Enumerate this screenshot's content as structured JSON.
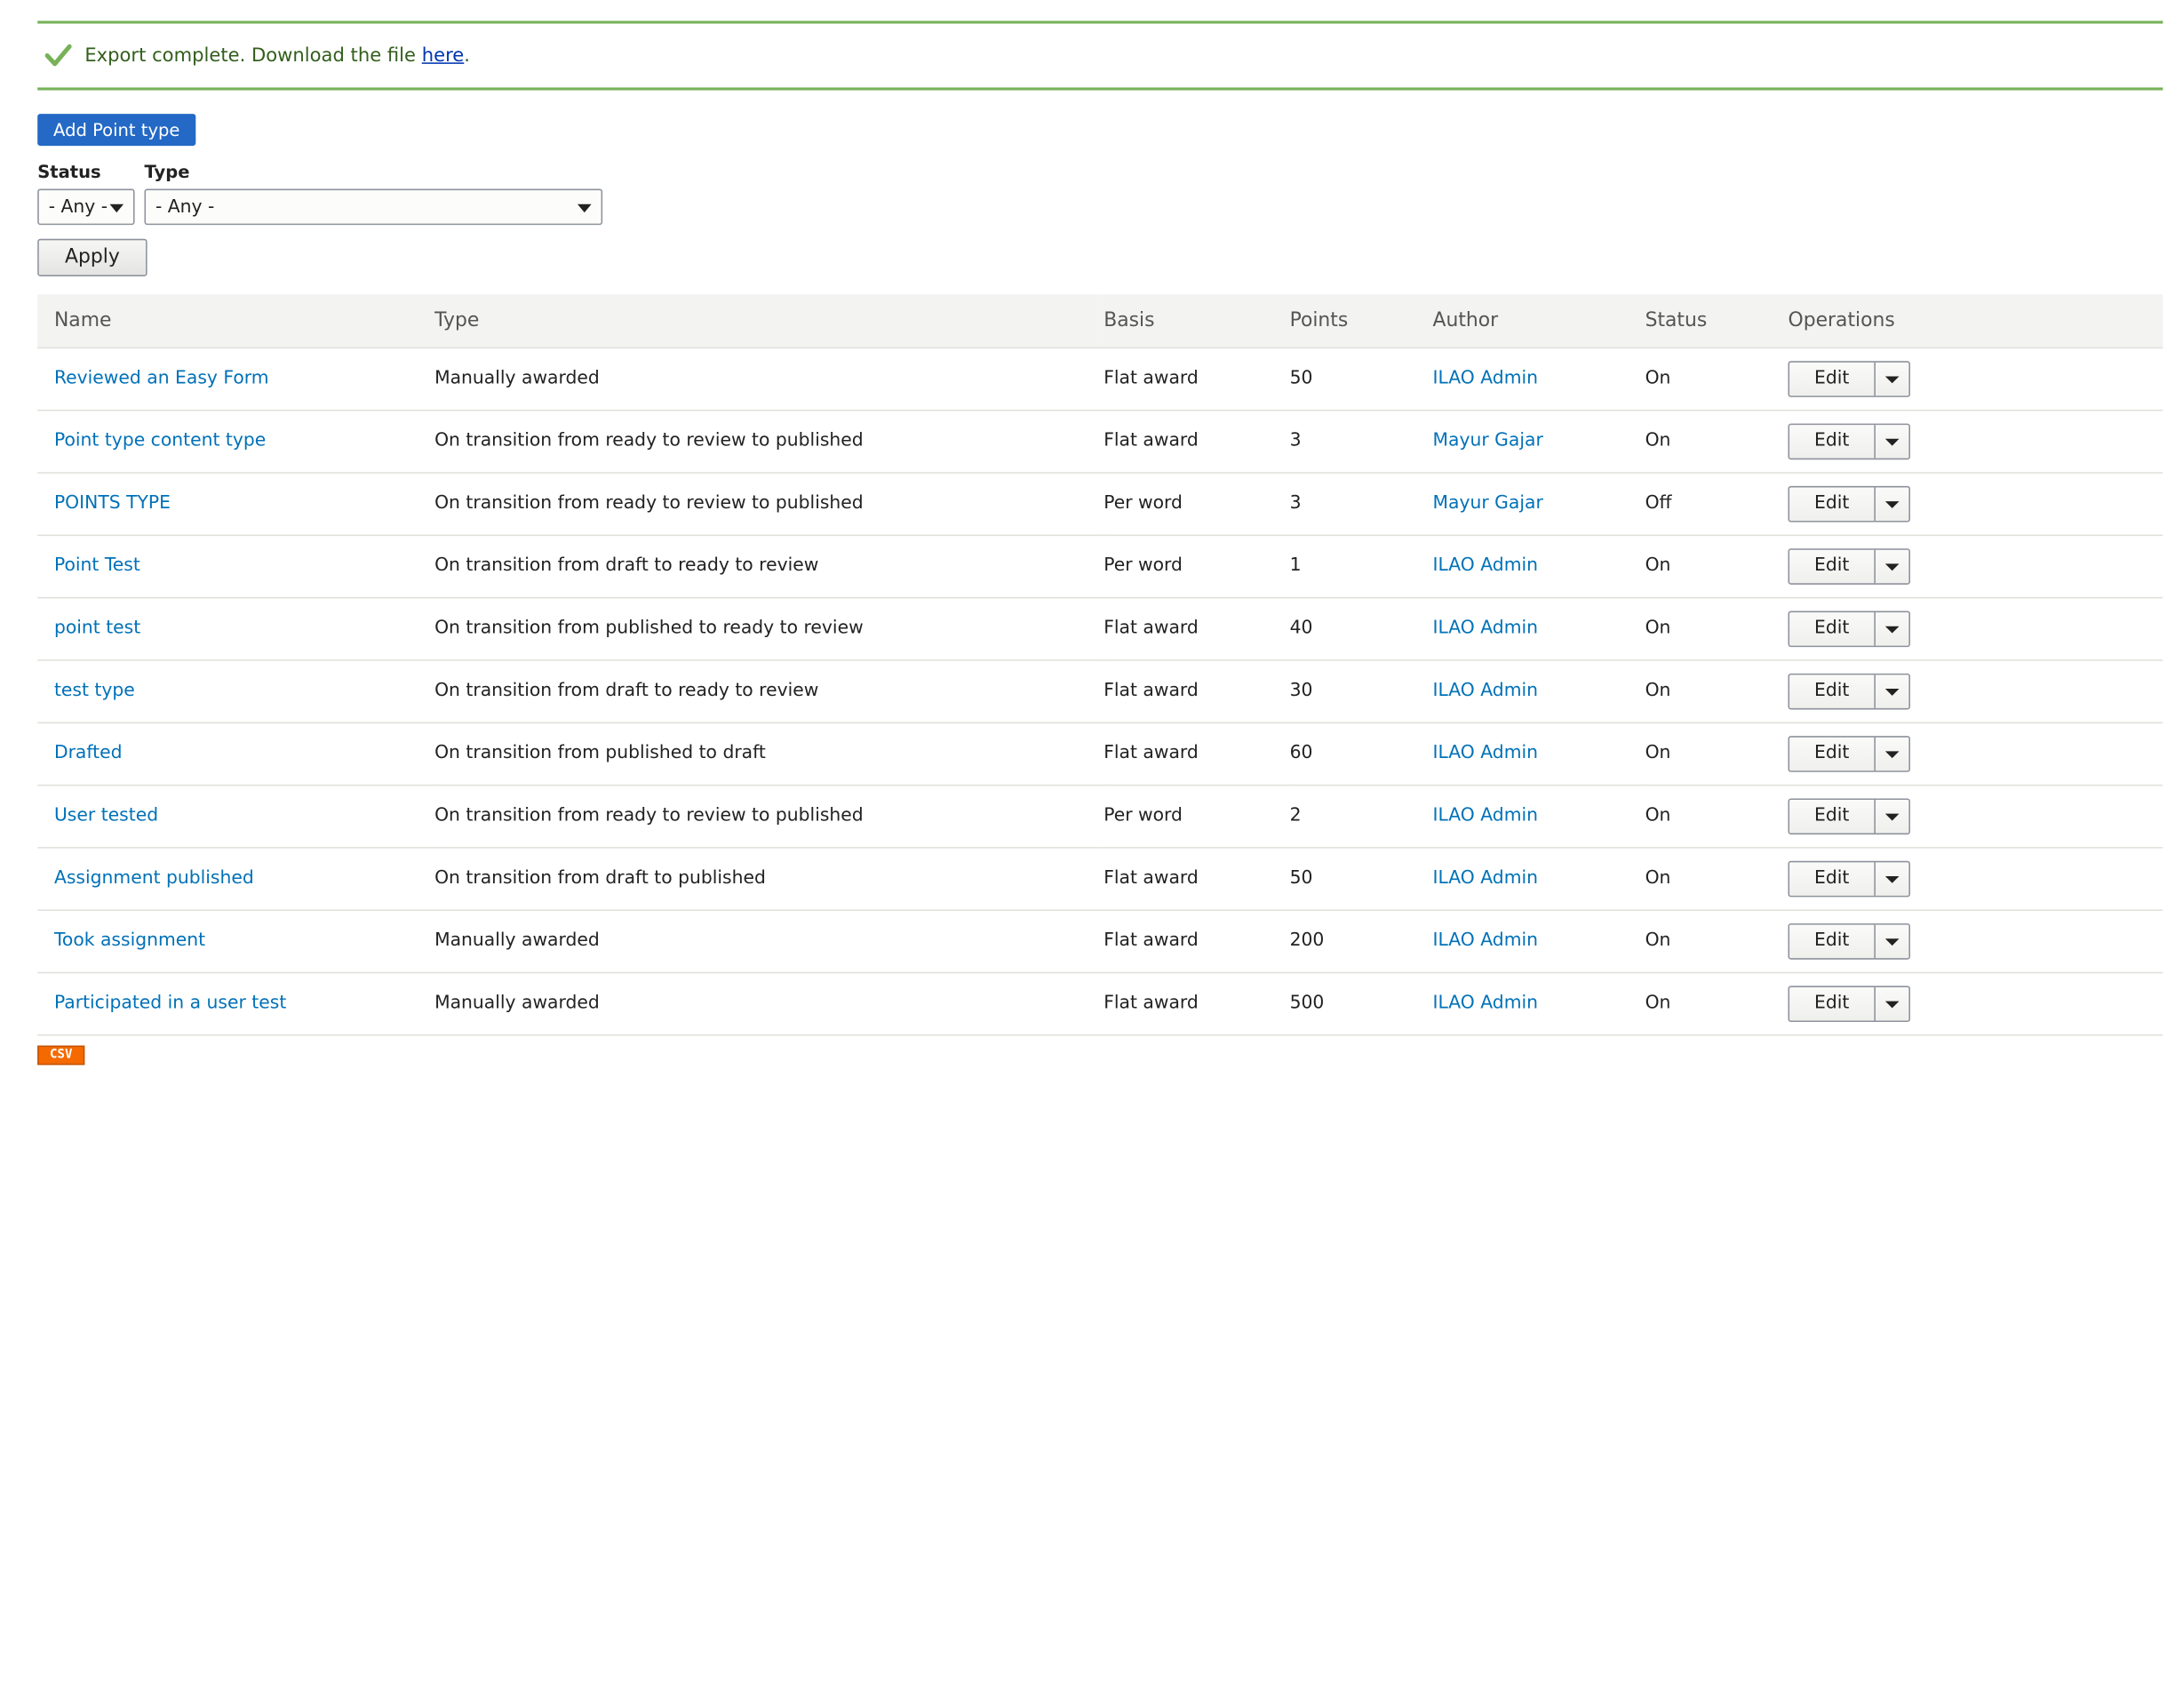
{
  "message": {
    "prefix": "Export complete. Download the file ",
    "link": "here",
    "suffix": ".",
    "icon": "checkmark-icon"
  },
  "add_button": "Add Point type",
  "filters": {
    "status": {
      "label": "Status",
      "value": "- Any -"
    },
    "type": {
      "label": "Type",
      "value": "- Any -"
    },
    "apply": "Apply"
  },
  "table": {
    "headers": [
      "Name",
      "Type",
      "Basis",
      "Points",
      "Author",
      "Status",
      "Operations"
    ],
    "edit_label": "Edit",
    "rows": [
      {
        "name": "Reviewed an Easy Form",
        "type": "Manually awarded",
        "basis": "Flat award",
        "points": "50",
        "author": "ILAO Admin",
        "status": "On"
      },
      {
        "name": "Point type content type",
        "type": "On transition from ready to review to published",
        "basis": "Flat award",
        "points": "3",
        "author": "Mayur Gajar",
        "status": "On"
      },
      {
        "name": "POINTS TYPE",
        "type": "On transition from ready to review to published",
        "basis": "Per word",
        "points": "3",
        "author": "Mayur Gajar",
        "status": "Off"
      },
      {
        "name": "Point Test",
        "type": "On transition from draft to ready to review",
        "basis": "Per word",
        "points": "1",
        "author": "ILAO Admin",
        "status": "On"
      },
      {
        "name": "point test",
        "type": "On transition from published to ready to review",
        "basis": "Flat award",
        "points": "40",
        "author": "ILAO Admin",
        "status": "On"
      },
      {
        "name": "test type",
        "type": "On transition from draft to ready to review",
        "basis": "Flat award",
        "points": "30",
        "author": "ILAO Admin",
        "status": "On"
      },
      {
        "name": "Drafted",
        "type": "On transition from published to draft",
        "basis": "Flat award",
        "points": "60",
        "author": "ILAO Admin",
        "status": "On"
      },
      {
        "name": "User tested",
        "type": "On transition from ready to review to published",
        "basis": "Per word",
        "points": "2",
        "author": "ILAO Admin",
        "status": "On"
      },
      {
        "name": "Assignment published",
        "type": "On transition from draft to published",
        "basis": "Flat award",
        "points": "50",
        "author": "ILAO Admin",
        "status": "On"
      },
      {
        "name": "Took assignment",
        "type": "Manually awarded",
        "basis": "Flat award",
        "points": "200",
        "author": "ILAO Admin",
        "status": "On"
      },
      {
        "name": "Participated in a user test",
        "type": "Manually awarded",
        "basis": "Flat award",
        "points": "500",
        "author": "ILAO Admin",
        "status": "On"
      }
    ]
  },
  "csv_label": "CSV",
  "colors": {
    "link": "#0071b8",
    "primary_button": "#2369c5",
    "success_border": "#77b259",
    "csv_badge": "#f46a00"
  }
}
